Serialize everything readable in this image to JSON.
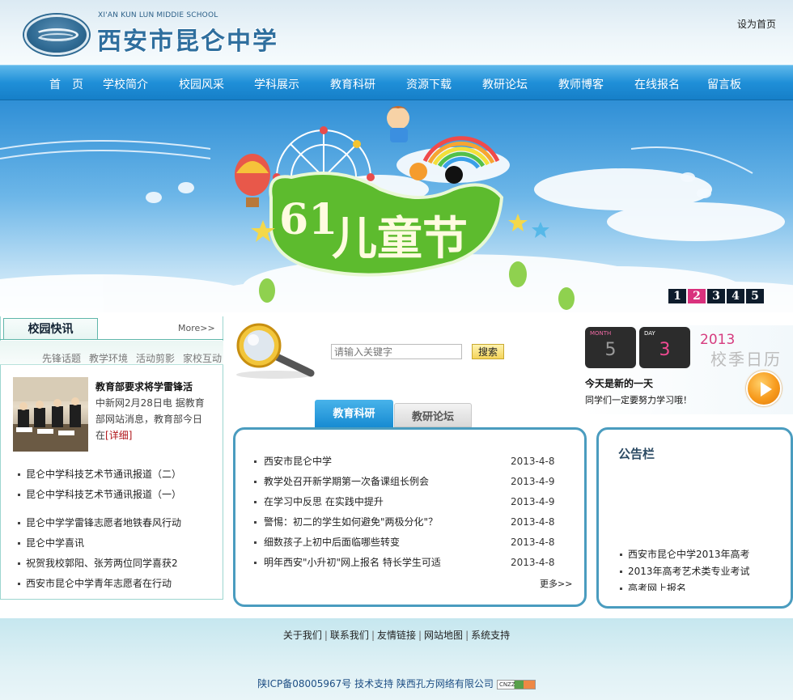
{
  "header": {
    "logo_en": "XI'AN KUN LUN MIDDIE SCHOOL",
    "logo_cn": "西安市昆仑中学",
    "set_home": "设为首页"
  },
  "nav": [
    "首　页",
    "学校简介",
    "校园风采",
    "学科展示",
    "教育科研",
    "资源下载",
    "教研论坛",
    "教师博客",
    "在线报名",
    "留言板"
  ],
  "banner": {
    "caption": "六一儿童节",
    "caption_main": "儿童节",
    "caption_num": "61",
    "pager": [
      "1",
      "2",
      "3",
      "4",
      "5"
    ],
    "active_page": 2
  },
  "news": {
    "tab": "校园快讯",
    "more": "More>>",
    "subtabs": [
      "先锋话题",
      "教学环境",
      "活动剪影",
      "家校互动"
    ],
    "feature_title": "教育部要求将学雷锋活",
    "feature_text": "中新网2月28日电 据教育部网站消息，教育部今日在",
    "feature_more": "[详细]",
    "items": [
      "昆仑中学科技艺术节通讯报道（二）",
      "昆仑中学科技艺术节通讯报道（一）",
      "昆仑中学学雷锋志愿者地铁春风行动",
      "昆仑中学喜讯",
      "祝贺我校郭阳、张芳两位同学喜获2",
      "西安市昆仑中学青年志愿者在行动"
    ]
  },
  "search": {
    "placeholder": "请输入关键字",
    "button": "搜索"
  },
  "research": {
    "tabs": [
      "教育科研",
      "教研论坛"
    ],
    "items": [
      {
        "title": "西安市昆仑中学",
        "date": "2013-4-8"
      },
      {
        "title": "教学处召开新学期第一次备课组长例会",
        "date": "2013-4-9"
      },
      {
        "title": "在学习中反思 在实践中提升",
        "date": "2013-4-9"
      },
      {
        "title": "警惕：初二的学生如何避免\"两极分化\"？",
        "date": "2013-4-8"
      },
      {
        "title": "细数孩子上初中后面临哪些转变",
        "date": "2013-4-8"
      },
      {
        "title": "明年西安\"小升初\"网上报名 特长学生可适",
        "date": "2013-4-8"
      }
    ],
    "more": "更多>>"
  },
  "calendar": {
    "month_label": "MONTH",
    "month": "5",
    "day_label": "DAY",
    "day": "3",
    "year": "2013",
    "season": "校季日历",
    "headline": "今天是新的一天",
    "sub": "同学们一定要努力学习哦！"
  },
  "notice": {
    "title": "公告栏",
    "items": [
      "西安市昆仑中学2013年高考",
      "2013年高考艺术类专业考试",
      "高考网上报名"
    ]
  },
  "footer": {
    "links": [
      "关于我们",
      "联系我们",
      "友情链接",
      "网站地图",
      "系统支持"
    ],
    "icp": "陕ICP备08005967号 技术支持 陕西孔方网络有限公司",
    "badge": "CNZZ"
  },
  "colors": {
    "nav_blue": "#1f8fd8",
    "panel_border": "#4a9cbf",
    "pager_active": "#d9317d",
    "link_red": "#b0161a"
  }
}
